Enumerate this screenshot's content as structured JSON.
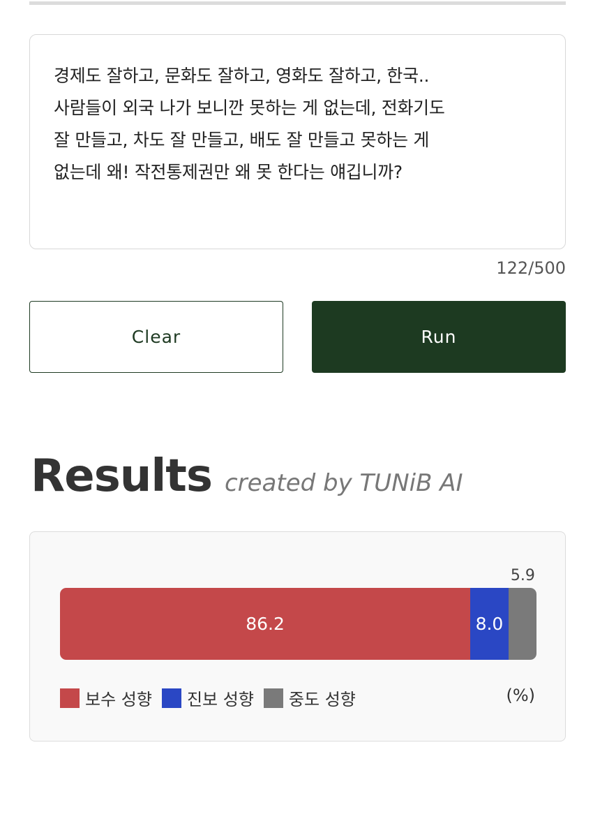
{
  "input": {
    "text": "경제도 잘하고, 문화도 잘하고, 영화도 잘하고, 한국..\n사람들이 외국 나가 보니깐 못하는 게 없는데, 전화기도\n잘 만들고, 차도 잘 만들고, 배도 잘 만들고 못하는 게\n없는데 왜! 작전통제권만 왜 못 한다는 얘깁니까?",
    "counter": "122/500"
  },
  "buttons": {
    "clear": "Clear",
    "run": "Run"
  },
  "results": {
    "title": "Results",
    "subtitle": "created by TUNiB AI",
    "unit": "(%)"
  },
  "chart_data": {
    "type": "bar",
    "orientation": "horizontal-stacked",
    "series": [
      {
        "name": "보수 성향",
        "value": 86.2,
        "label": "86.2",
        "color": "#c4484a"
      },
      {
        "name": "진보 성향",
        "value": 8.0,
        "label": "8.0",
        "color": "#2a47c4"
      },
      {
        "name": "중도 성향",
        "value": 5.9,
        "label": "5.9",
        "color": "#7a7a7a"
      }
    ],
    "legend": "bottom-left",
    "unit": "(%)"
  }
}
